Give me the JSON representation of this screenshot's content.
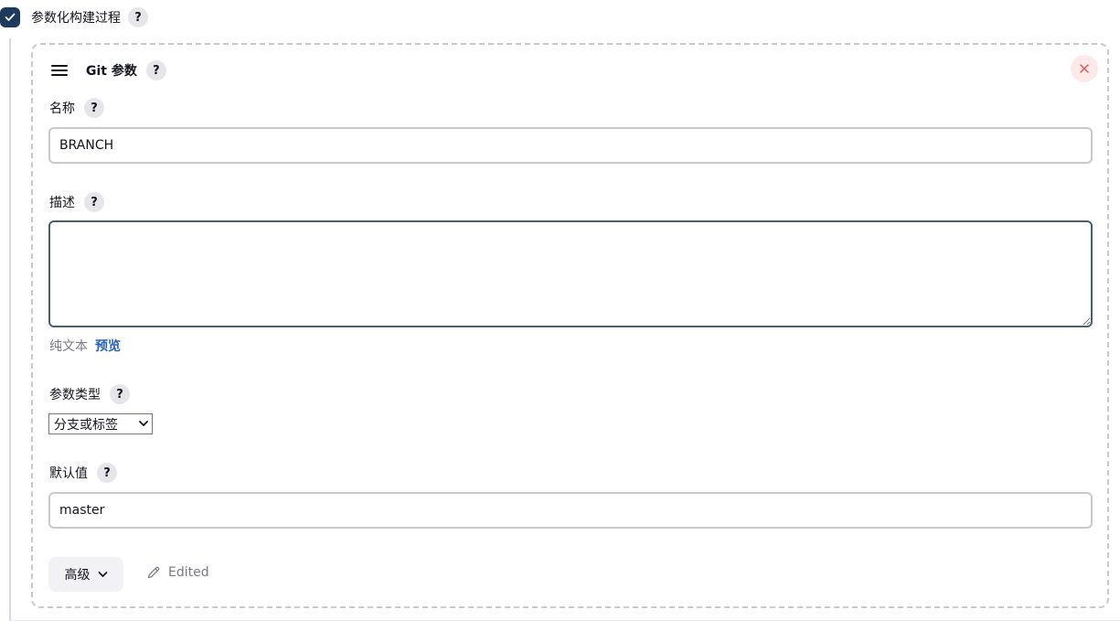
{
  "parameterized": {
    "label": "参数化构建过程",
    "checked": true,
    "help": "?"
  },
  "card": {
    "title": "Git 参数",
    "help": "?",
    "close_icon": "close-icon",
    "drag_icon": "drag-handle-icon"
  },
  "fields": {
    "name": {
      "label": "名称",
      "help": "?",
      "value": "BRANCH"
    },
    "description": {
      "label": "描述",
      "help": "?",
      "value": "",
      "format_plain": "纯文本",
      "format_preview": "预览"
    },
    "param_type": {
      "label": "参数类型",
      "help": "?",
      "selected": "分支或标签"
    },
    "default_value": {
      "label": "默认值",
      "help": "?",
      "value": "master"
    }
  },
  "actions": {
    "advanced_label": "高级",
    "edited_label": "Edited"
  },
  "colors": {
    "checkbox": "#1d3a5c",
    "link": "#2563b8",
    "close": "#d9534f"
  }
}
